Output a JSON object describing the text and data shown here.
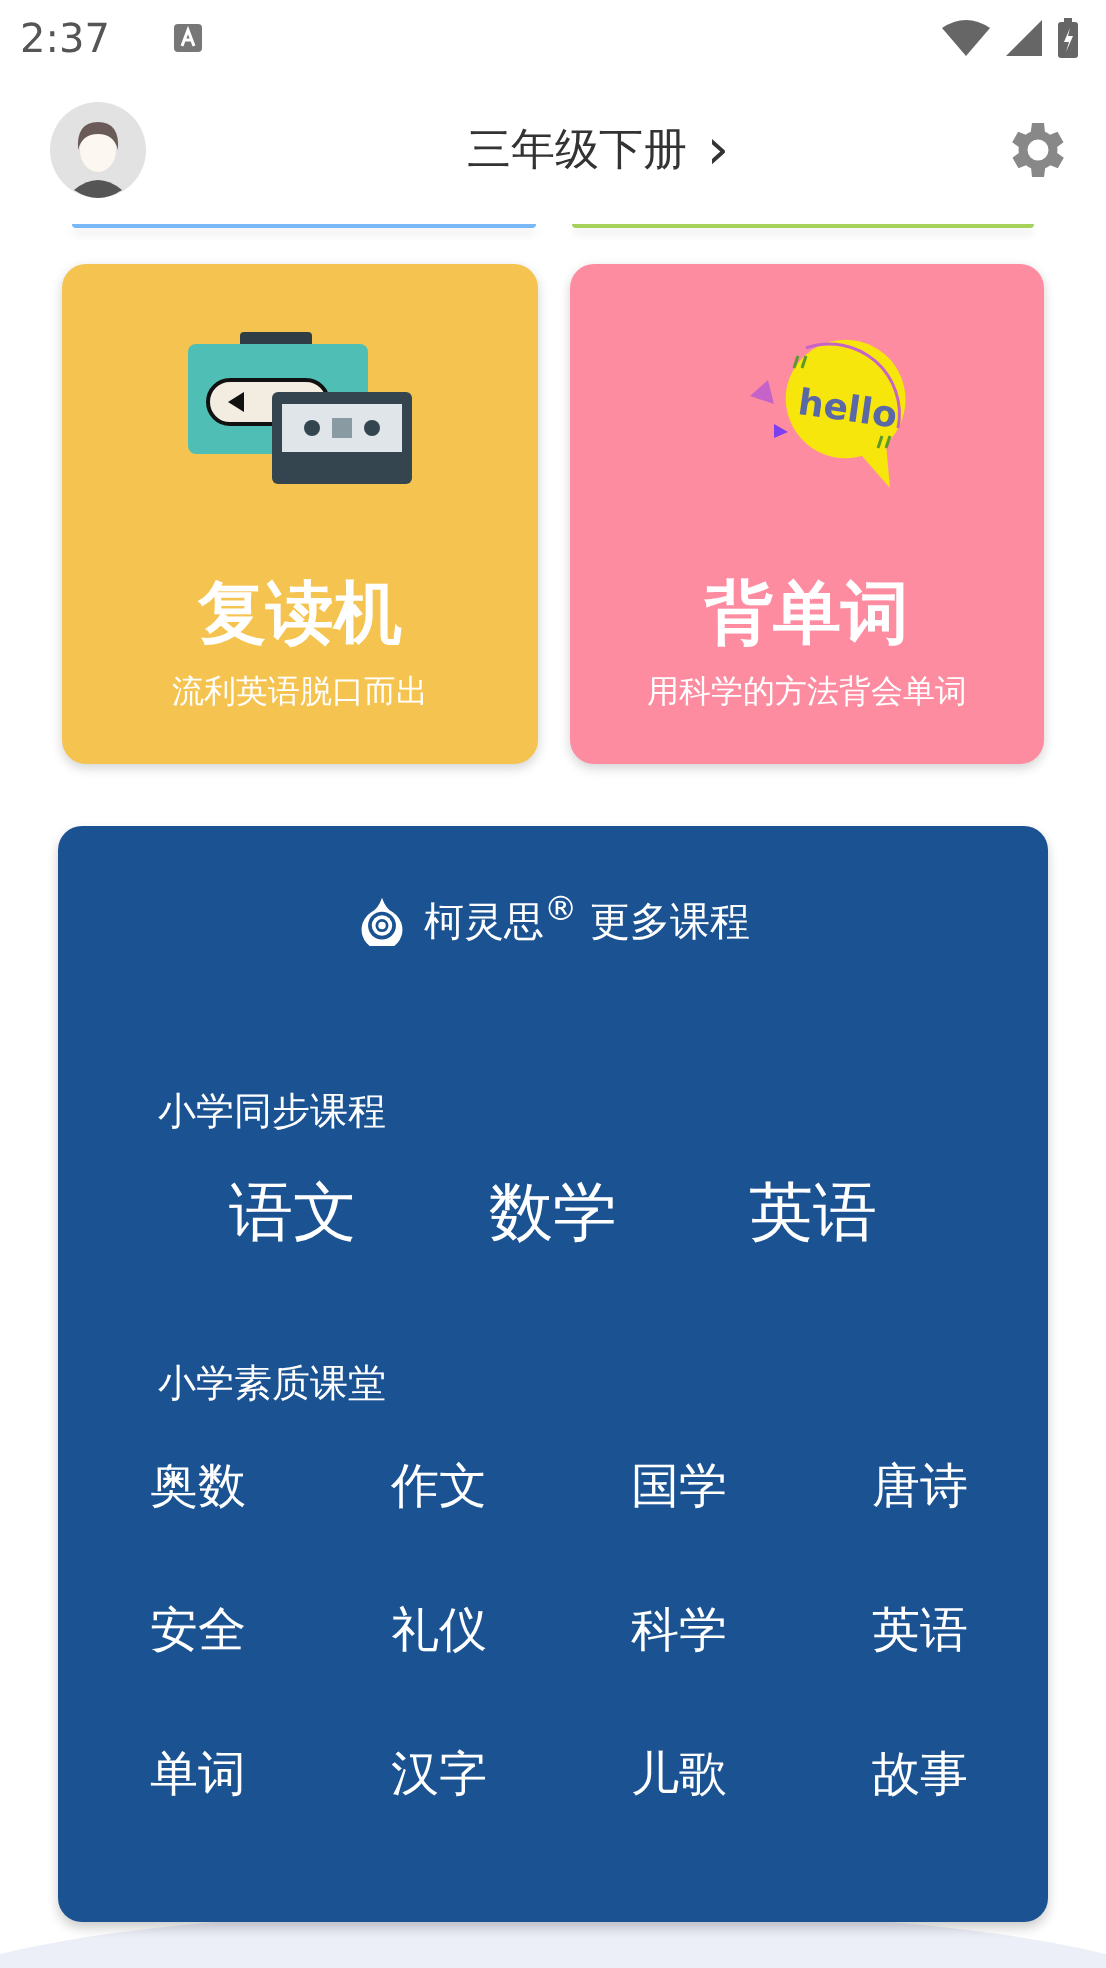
{
  "status_bar": {
    "time": "2:37"
  },
  "header": {
    "title": "三年级下册",
    "chevron": "›"
  },
  "cards": [
    {
      "kind": "player",
      "title": "复读机",
      "subtitle": "流利英语脱口而出",
      "color": "#f5c34f"
    },
    {
      "kind": "hello",
      "title": "背单词",
      "subtitle": "用科学的方法背会单词",
      "color": "#fe8ca1"
    }
  ],
  "panel": {
    "brand": "柯灵思$^{®}$ 更多课程",
    "sections": [
      {
        "heading": "小学同步课程",
        "kind": "large",
        "items": [
          "语文",
          "数学",
          "英语"
        ]
      },
      {
        "heading": "小学素质课堂",
        "kind": "grid",
        "items": [
          "奥数",
          "作文",
          "国学",
          "唐诗",
          "安全",
          "礼仪",
          "科学",
          "英语",
          "单词",
          "汉字",
          "儿歌",
          "故事"
        ]
      }
    ]
  }
}
